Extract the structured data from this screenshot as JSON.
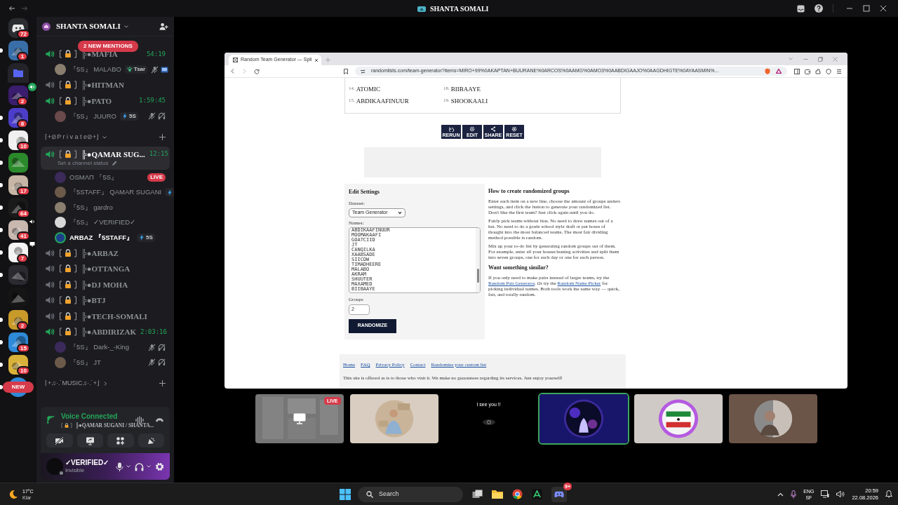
{
  "titlebar": {
    "title": "SHANTA SOMALI"
  },
  "servers": [
    {
      "kind": "home",
      "badge": "72",
      "unread": false
    },
    {
      "kind": "server",
      "badge": "1",
      "unread": true
    },
    {
      "kind": "folder",
      "unread": false
    },
    {
      "kind": "voice",
      "badge": "2",
      "unread": false
    },
    {
      "kind": "server",
      "badge": "8",
      "unread": true
    },
    {
      "kind": "server",
      "badge": "10",
      "unread": true
    },
    {
      "kind": "server",
      "unread": true
    },
    {
      "kind": "server",
      "badge": "17",
      "unread": true
    },
    {
      "kind": "server",
      "badge": "64",
      "unread": true
    },
    {
      "kind": "audio",
      "badge": "41",
      "unread": true
    },
    {
      "kind": "stream",
      "badge": "7",
      "unread": true
    },
    {
      "kind": "server",
      "unread": true
    },
    {
      "kind": "server",
      "unread": false
    },
    {
      "kind": "server",
      "badge": "2",
      "unread": true
    },
    {
      "kind": "server",
      "badge": "15",
      "unread": true
    },
    {
      "kind": "server",
      "badge": "10",
      "unread": true
    },
    {
      "kind": "new",
      "label": "NEW",
      "unread": true
    }
  ],
  "sidebar": {
    "server_name": "SHANTA SOMALI",
    "mentions": "2 NEW MENTIONS",
    "channels": [
      {
        "kind": "voice",
        "name": "╠●MAFIA",
        "active": true,
        "selected": false,
        "time": "54:19",
        "users": [
          {
            "name": "『5S』 MALABO",
            "tag": {
              "kind": "paw",
              "text": "Tsar"
            },
            "muted": true,
            "deafened": false,
            "video": true,
            "speaking": false
          }
        ]
      },
      {
        "kind": "voice",
        "name": "╠●HITMAN",
        "active": false,
        "selected": false
      },
      {
        "kind": "voice",
        "name": "╠●PATO",
        "active": true,
        "selected": false,
        "time": "1:59:45",
        "users": [
          {
            "name": "『5S』 JUURO",
            "tag": {
              "kind": "bolt",
              "text": "5S"
            },
            "muted": true,
            "deafened": true,
            "video": false,
            "speaking": false
          }
        ]
      },
      {
        "kind": "category",
        "name": "⌈+⊘P r i v a t e⊘+⌋",
        "expanded": true
      },
      {
        "kind": "voice",
        "name": "╠●QAMAR SUG...",
        "active": true,
        "selected": true,
        "time": "12:15",
        "status": "Set a channel status",
        "users": [
          {
            "name": "OSMΛП 『5S』",
            "badge": "LIVE",
            "muted": false,
            "deafened": false,
            "video": false,
            "speaking": false
          },
          {
            "name": "『5STAFF』 QAMAR SUGANI",
            "tag": {
              "kind": "bolt"
            },
            "muted": false,
            "deafened": false,
            "video": false,
            "speaking": false
          },
          {
            "name": "『5S』 gardro",
            "muted": false,
            "deafened": false,
            "video": false,
            "speaking": false
          },
          {
            "name": "『5S』 ✓VERIFIED✓",
            "muted": false,
            "deafened": false,
            "video": false,
            "speaking": false
          },
          {
            "name": "ARBAZ 『5STAFF』",
            "tag": {
              "kind": "bolt",
              "text": "5S"
            },
            "muted": false,
            "deafened": false,
            "video": false,
            "speaking": true
          }
        ]
      },
      {
        "kind": "voice",
        "name": "╠●ARBAZ",
        "active": false,
        "selected": false
      },
      {
        "kind": "voice",
        "name": "╠●OTTANGA",
        "active": false,
        "selected": false
      },
      {
        "kind": "voice",
        "name": "╠●DJ MOHA",
        "active": false,
        "selected": false
      },
      {
        "kind": "voice",
        "name": "╠●BTJ",
        "active": false,
        "selected": false
      },
      {
        "kind": "voice",
        "name": "╠●TECH-SOMALI",
        "active": false,
        "selected": false
      },
      {
        "kind": "voice",
        "name": "╠●ABDIRIZAK",
        "active": true,
        "selected": false,
        "time": "2:03:16",
        "users": [
          {
            "name": "『5S』 Dark-_-King",
            "muted": true,
            "deafened": true,
            "video": false,
            "speaking": false
          },
          {
            "name": "『5S』 JT",
            "muted": true,
            "deafened": true,
            "video": false,
            "speaking": false
          }
        ]
      },
      {
        "kind": "category",
        "name": "⌈+♫·.˙MUSIC♫·.˙+⌋",
        "expanded": false
      }
    ]
  },
  "voice_panel": {
    "title": "Voice Connected",
    "channel": "╠●QAMAR SUGANI / SHANTA..."
  },
  "user_panel": {
    "name": "✓VERIFIED✓",
    "status": "Invisible"
  },
  "browser": {
    "tab": "Random Team Generator — Spli",
    "url": "randomlists.com/team-generator?items=MIRO+99%0AKAPTAN+BUURANE%0ARCOS%0AAMG%0AMO3%0AABDIGAAJO%0AAGDHIGTE%0AYAASMIN%...",
    "results": [
      {
        "num": "14.",
        "name": "ATOMIC"
      },
      {
        "num": "18.",
        "name": "BIIBAAYE"
      },
      {
        "num": "15.",
        "name": "ABDIKAAFINUUR"
      },
      {
        "num": "19.",
        "name": "SHOOKAALI"
      }
    ],
    "actions": [
      "RERUN",
      "EDIT",
      "SHARE",
      "RESET"
    ],
    "settings": {
      "title": "Edit Settings",
      "dataset_label": "Dataset:",
      "dataset": "Team Generator",
      "names_label": "Names:",
      "names": [
        "ABDIKAAFINUUR",
        "MOOMAKAAFI",
        "GOATCIID",
        "JT",
        "CANQILKA",
        "XAABSADE",
        "SIICOW",
        "TIMADHEERE",
        "MALABO",
        "AKRAM",
        "SHUUTER",
        "MAXAMED",
        "BIIBAAYE"
      ],
      "groups_label": "Groups",
      "groups": "2",
      "button": "RANDOMIZE"
    },
    "howto": {
      "title": "How to create randomized groups",
      "paragraphs": [
        "Enter each item on a new line, choose the amount of groups unders settings, and click the button to generate your randomized list. Don't like the first team? Just click again until you do.",
        "Fairly pick teams without bias. No need to draw names out of a hat. No need to do a grade school style draft or put hours of thought into the most balanced teams. The most fair dividing method possible is random.",
        "Mix up your to-do list by generating random groups out of them. For example, enter all your housecleaning activities and split them into seven groups, one for each day or one for each person."
      ],
      "subtitle": "Want something similar?",
      "similar": [
        {
          "kind": "text",
          "text": "If you only need to make pairs instead of larger teams, try the "
        },
        {
          "kind": "link",
          "text": "Random Pair Generator"
        },
        {
          "kind": "text",
          "text": ". Or try the "
        },
        {
          "kind": "link",
          "text": "Random Name Picker"
        },
        {
          "kind": "text",
          "text": " for picking individual names. Both tools work the same way — quick, fair, and totally random."
        }
      ]
    },
    "footer_links": [
      "Home",
      "FAQ",
      "Privacy Policy",
      "Contact",
      "Randomize your custom list"
    ],
    "disclaimer": "This site is offered as is to those who visit it. We make no guarantees regarding its services. Just enjoy yourself!"
  },
  "tiles": [
    {
      "kind": "stream",
      "badge": "LIVE",
      "selected": false
    },
    {
      "kind": "avatar",
      "selected": false
    },
    {
      "kind": "caption",
      "text": "I see you !!",
      "selected": false
    },
    {
      "kind": "avatar",
      "selected": true
    },
    {
      "kind": "avatar",
      "selected": false
    },
    {
      "kind": "avatar",
      "selected": false
    }
  ],
  "taskbar": {
    "temperature": "17°C",
    "condition": "Klar",
    "search": "Search",
    "discord_badge": "9+",
    "language": "ENG",
    "layout": "SF",
    "time": "20:59",
    "date": "22.08.2026"
  }
}
